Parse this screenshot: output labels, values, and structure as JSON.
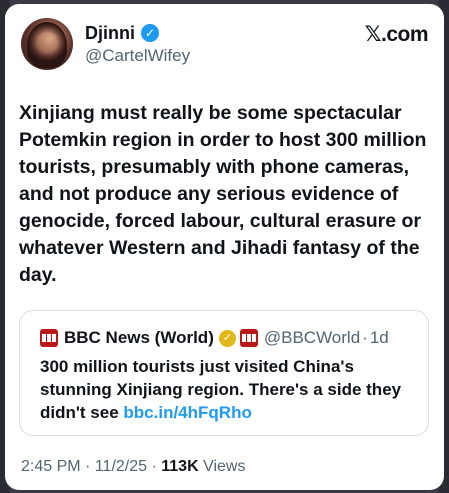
{
  "author": {
    "display_name": "Djinni",
    "handle": "@CartelWifey",
    "verified_icon": "verified-badge-blue",
    "brand": "𝕏.com"
  },
  "tweet": {
    "text": "Xinjiang must really be some spectacular Potemkin region in order to host 300 million tourists, presumably with phone cameras, and not produce any serious evidence of genocide, forced labour, cultural erasure or whatever Western and Jihadi fantasy of the day."
  },
  "quoted_tweet": {
    "display_name": "BBC News (World)",
    "handle": "@BBCWorld",
    "separator": "·",
    "time": "1d",
    "text": "300 million tourists just visited China's stunning Xinjiang region. There's a side they didn't see",
    "link": "bbc.in/4hFqRho",
    "badge_icon": "gold-verified-badge",
    "logo_icon": "bbc-logo"
  },
  "meta": {
    "time": "2:45 PM",
    "separator": "·",
    "date": "11/2/25",
    "views_count": "113K",
    "views_label": "Views"
  },
  "colors": {
    "accent": "#1d9bf0",
    "bbc_red": "#bb1919",
    "gold": "#e2b719"
  }
}
